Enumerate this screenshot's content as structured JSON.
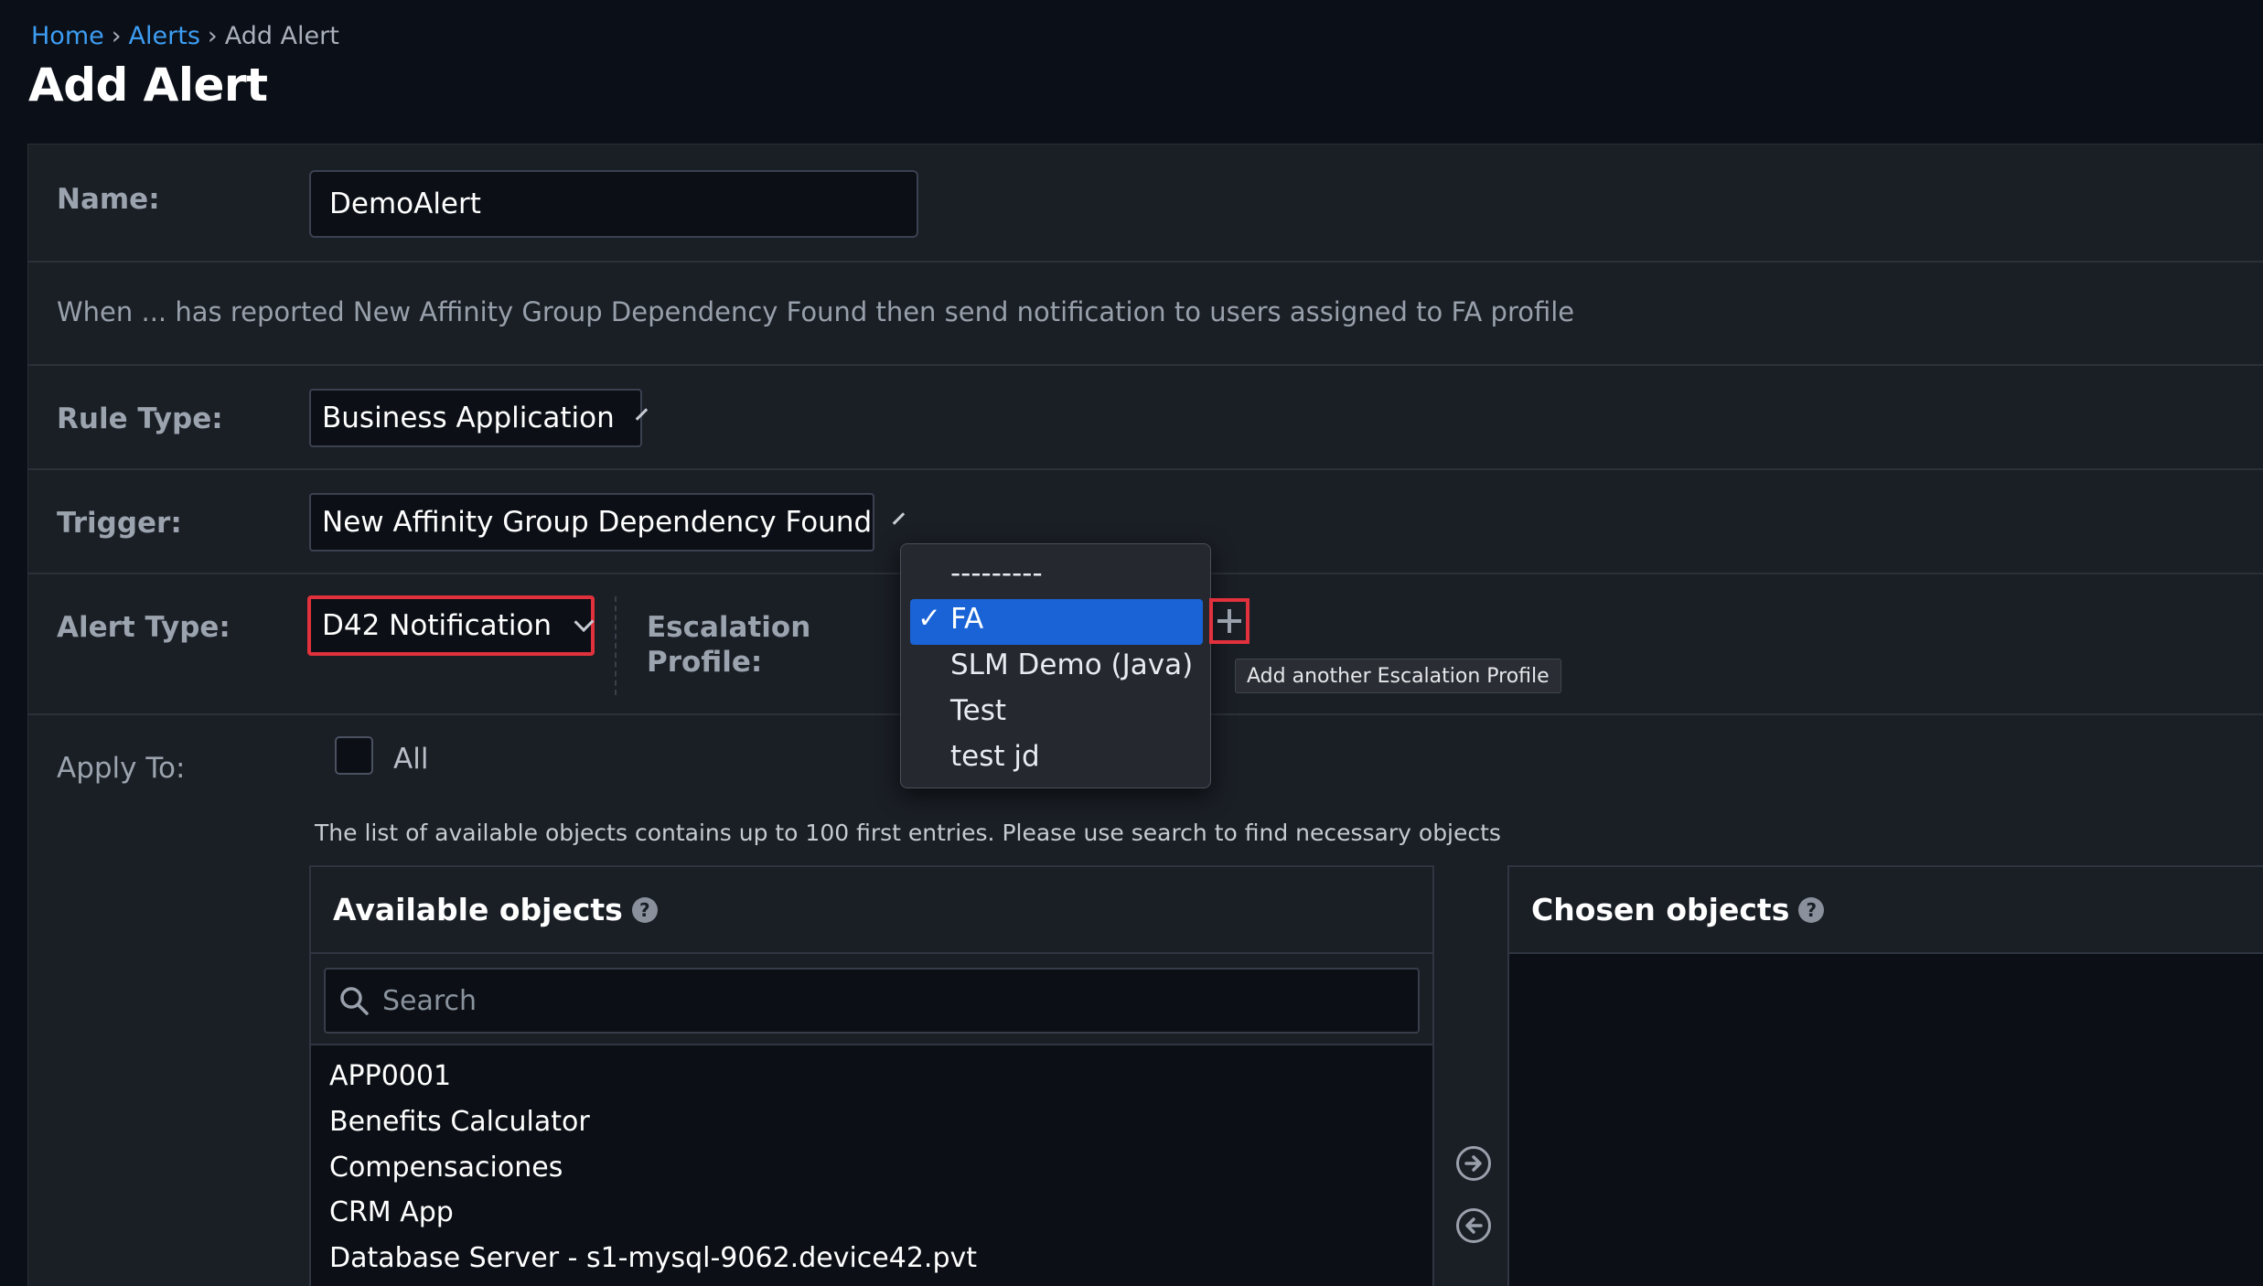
{
  "breadcrumb": {
    "home": "Home",
    "alerts": "Alerts",
    "separator": "›",
    "current": "Add Alert"
  },
  "page_title": "Add Alert",
  "form": {
    "name_label": "Name:",
    "name_value": "DemoAlert",
    "description": "When ... has reported New Affinity Group Dependency Found then send notification to users assigned to FA profile",
    "rule_type_label": "Rule Type:",
    "rule_type_value": "Business Application",
    "trigger_label": "Trigger:",
    "trigger_value": "New Affinity Group Dependency Found",
    "alert_type_label": "Alert Type:",
    "alert_type_value": "D42 Notification",
    "escalation_label_line1": "Escalation",
    "escalation_label_line2": "Profile:",
    "apply_to_label": "Apply To:",
    "all_label": "All",
    "info_text": "The list of available objects contains up to 100 first entries. Please use search to find necessary objects"
  },
  "escalation_dropdown": {
    "options": [
      "---------",
      "FA",
      "SLM Demo (Java)",
      "Test",
      "test jd"
    ],
    "selected": "FA",
    "check_glyph": "✓"
  },
  "add_profile_tooltip": "Add another Escalation Profile",
  "available": {
    "title": "Available objects",
    "help": "?",
    "search_placeholder": "Search",
    "items": [
      "APP0001",
      "Benefits Calculator",
      "Compensaciones",
      "CRM App",
      "Database Server - s1-mysql-9062.device42.pvt"
    ]
  },
  "chosen": {
    "title": "Chosen objects",
    "help": "?"
  },
  "icons": {
    "search": "search-icon",
    "chevron": "chevron-down-icon",
    "plus": "plus-icon",
    "move_right": "arrow-right-circle-icon",
    "move_left": "arrow-left-circle-icon",
    "help": "help-circle-icon"
  },
  "colors": {
    "accent_red": "#e0313c",
    "selected_blue": "#1a63d6",
    "link_blue": "#3d9df3"
  }
}
